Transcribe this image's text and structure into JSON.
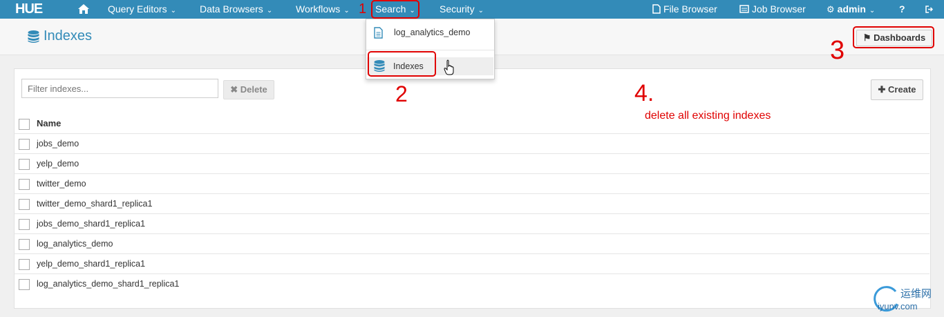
{
  "nav": {
    "logo": "HUE",
    "items": [
      "Query Editors",
      "Data Browsers",
      "Workflows",
      "Search",
      "Security"
    ],
    "right": [
      "File Browser",
      "Job Browser",
      "admin"
    ]
  },
  "header": {
    "title": "Indexes",
    "dashboards_label": "Dashboards"
  },
  "search_menu": {
    "items": [
      "log_analytics_demo",
      "Indexes"
    ]
  },
  "toolbar": {
    "filter_placeholder": "Filter indexes...",
    "delete_label": "Delete",
    "create_label": "Create"
  },
  "table": {
    "column": "Name",
    "rows": [
      "jobs_demo",
      "yelp_demo",
      "twitter_demo",
      "twitter_demo_shard1_replica1",
      "jobs_demo_shard1_replica1",
      "log_analytics_demo",
      "yelp_demo_shard1_replica1",
      "log_analytics_demo_shard1_replica1"
    ]
  },
  "annotations": {
    "step1": "1",
    "step2": "2",
    "step3": "3",
    "step4": "4.",
    "note": "delete all existing indexes"
  },
  "watermark": {
    "cn": "运维网",
    "domain": "iyunv.com"
  },
  "colors": {
    "nav": "#338bb8",
    "annotation_red": "#e00000"
  }
}
